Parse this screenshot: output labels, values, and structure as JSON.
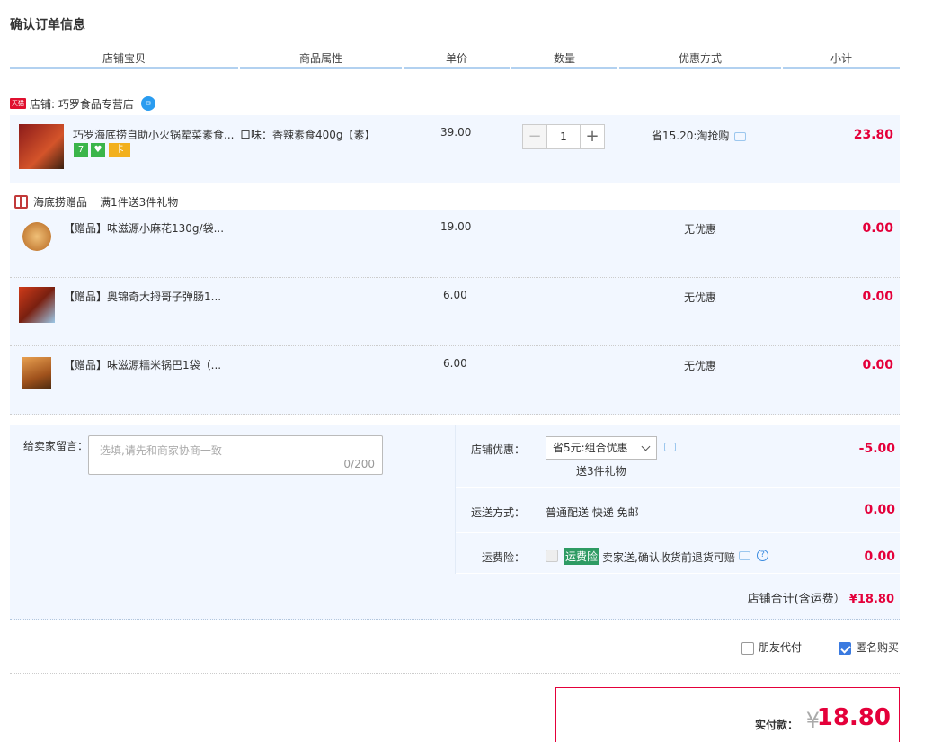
{
  "page_title": "确认订单信息",
  "columns": [
    "店铺宝贝",
    "商品属性",
    "单价",
    "数量",
    "优惠方式",
    "小计"
  ],
  "shop": {
    "tmall_badge": "天猫",
    "label": "店铺: 巧罗食品专营店",
    "chat_icon": "wangwang-icon"
  },
  "main_item": {
    "name": "巧罗海底捞自助小火锅荤菜素食...",
    "attribute": "口味：香辣素食400g【素】",
    "price": "39.00",
    "quantity": "1",
    "minus": "−",
    "plus": "+",
    "promo": "省15.20:淘抢购",
    "subtotal": "23.80",
    "badges": [
      "7",
      "♥",
      "卡"
    ]
  },
  "gift_group": {
    "label": "海底捞赠品",
    "rule": "满1件送3件礼物"
  },
  "gifts": [
    {
      "name": "【赠品】味滋源小麻花130g/袋...",
      "price": "19.00",
      "promo": "无优惠",
      "subtotal": "0.00"
    },
    {
      "name": "【赠品】奥锦奇大拇哥子弹肠1...",
      "price": "6.00",
      "promo": "无优惠",
      "subtotal": "0.00"
    },
    {
      "name": "【赠品】味滋源糯米锅巴1袋（...",
      "price": "6.00",
      "promo": "无优惠",
      "subtotal": "0.00"
    }
  ],
  "message": {
    "label": "给卖家留言：",
    "placeholder": "选填,请先和商家协商一致",
    "count": "0/200"
  },
  "shop_discount": {
    "label": "店铺优惠：",
    "selected": "省5元:组合优惠",
    "note": "送3件礼物",
    "value": "-5.00"
  },
  "shipping": {
    "label": "运送方式：",
    "text": "普通配送 快递 免邮",
    "value": "0.00"
  },
  "insurance": {
    "label": "运费险：",
    "tag": "运费险",
    "text": "卖家送,确认收货前退货可赔",
    "value": "0.00"
  },
  "shop_total": {
    "label": "店铺合计(含运费）",
    "value": "¥18.80"
  },
  "options": {
    "friend_pay": "朋友代付",
    "anonymous": "匿名购买"
  },
  "payment": {
    "label": "实付款：",
    "yen": "¥",
    "amount": "18.80"
  }
}
